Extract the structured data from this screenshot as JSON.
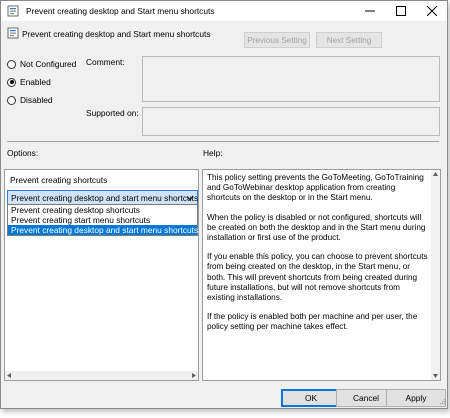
{
  "window": {
    "title": "Prevent creating desktop and Start menu shortcuts",
    "icons": {
      "app": "policy-icon",
      "minimize": "minimize-icon",
      "maximize": "maximize-icon",
      "close": "close-icon"
    }
  },
  "header": {
    "title": "Prevent creating desktop and Start menu shortcuts",
    "prev_label": "Previous Setting",
    "next_label": "Next Setting"
  },
  "state": {
    "options": [
      {
        "label": "Not Configured",
        "checked": false
      },
      {
        "label": "Enabled",
        "checked": true
      },
      {
        "label": "Disabled",
        "checked": false
      }
    ]
  },
  "fields": {
    "comment_label": "Comment:",
    "supported_label": "Supported on:"
  },
  "options_panel": {
    "label": "Options:",
    "heading": "Prevent creating shortcuts",
    "selected_value": "Prevent creating desktop and start menu shortcuts",
    "dropdown_items": [
      "Prevent creating desktop shortcuts",
      "Prevent creating start menu shortcuts",
      "Prevent creating desktop and start menu shortcuts"
    ]
  },
  "help_panel": {
    "label": "Help:",
    "paragraphs": [
      "This policy setting prevents the GoToMeeting, GoToTraining and GoToWebinar desktop application from creating shortcuts on the desktop or in the Start menu.",
      "When the policy is disabled or not configured, shortcuts will be created on both the desktop and in the Start menu during installation or first use of the product.",
      "If you enable this policy, you can choose to prevent shortcuts from being created on the desktop, in the Start menu, or both. This will prevent shortcuts from being created during future installations, but will not remove shortcuts from existing installations.",
      "If the policy is enabled both per machine and per user, the policy setting per machine takes effect."
    ]
  },
  "footer": {
    "ok_label": "OK",
    "cancel_label": "Cancel",
    "apply_label": "Apply"
  },
  "colors": {
    "accent": "#0078d7",
    "selection_highlight": "#cfe3f7",
    "window_bg": "#f0f0f0"
  }
}
